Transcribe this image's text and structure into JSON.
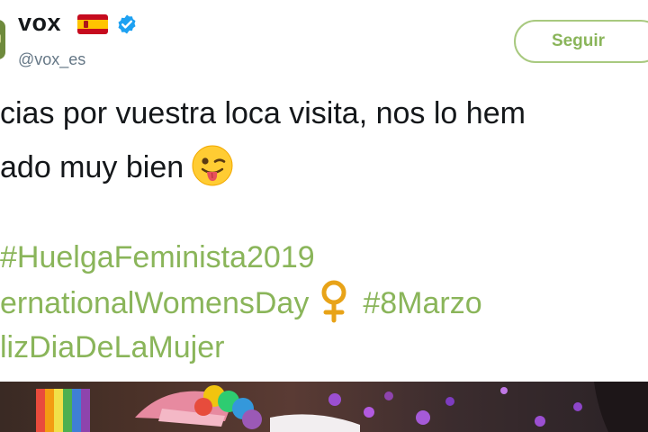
{
  "account": {
    "display_name": "vox",
    "handle": "@vox_es",
    "verified": true,
    "flag": "spain-flag-icon"
  },
  "follow_button": {
    "label": "Seguir"
  },
  "tweet": {
    "line1": "cias por vuestra loca visita, nos lo hem",
    "line2": "ado muy bien",
    "hashtag1": "#HuelgaFeminista2019",
    "hashtag2": "ernationalWomensDay",
    "hashtag3": "#8Marzo",
    "hashtag4": "lizDiaDeLaMujer",
    "emoji": "winking-face-tongue-icon",
    "symbol": "venus-icon"
  },
  "colors": {
    "hashtag": "#8ab55a",
    "follow_border": "#a8c97f",
    "text": "#14171a",
    "muted": "#657786",
    "verified": "#1da1f2"
  }
}
